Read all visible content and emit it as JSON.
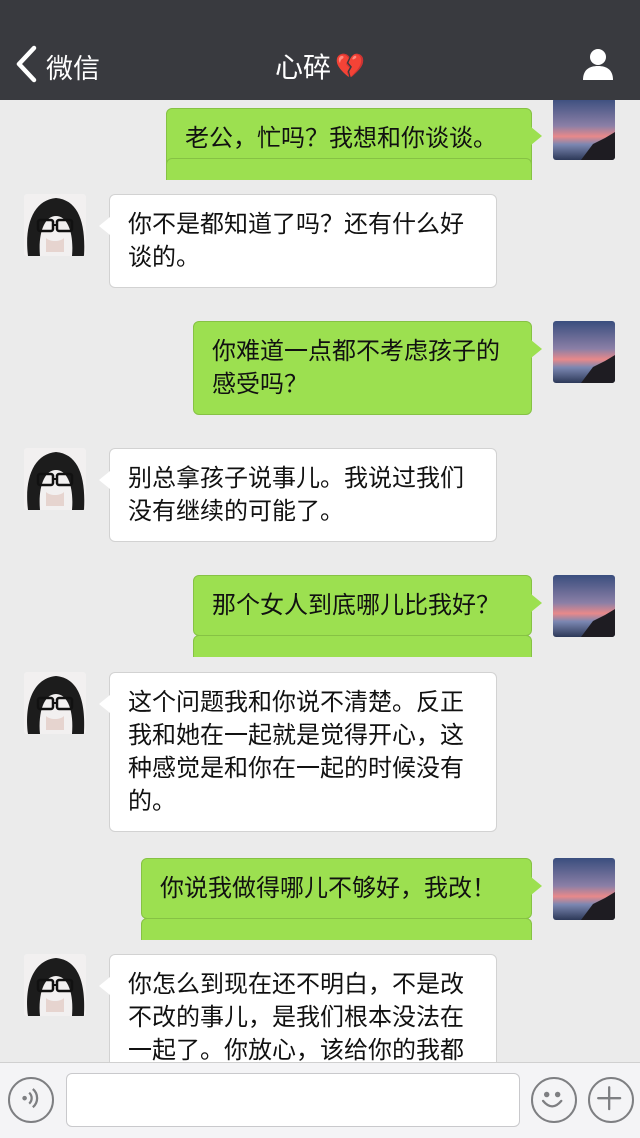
{
  "header": {
    "back_label": "微信",
    "title": "心碎",
    "title_emoji": "💔",
    "icons": {
      "back": "chevron-left-icon",
      "profile": "person-icon"
    }
  },
  "messages": [
    {
      "sender": "me",
      "text": "老公，忙吗？我想和你谈谈。"
    },
    {
      "sender": "her",
      "text": "你不是都知道了吗？还有什么好谈的。"
    },
    {
      "sender": "me",
      "text": "你难道一点都不考虑孩子的感受吗？"
    },
    {
      "sender": "her",
      "text": "别总拿孩子说事儿。我说过我们没有继续的可能了。"
    },
    {
      "sender": "me",
      "text": "那个女人到底哪儿比我好？"
    },
    {
      "sender": "her",
      "text": "这个问题我和你说不清楚。反正我和她在一起就是觉得开心，这种感觉是和你在一起的时候没有的。"
    },
    {
      "sender": "me",
      "text": "你说我做得哪儿不够好，我改！"
    },
    {
      "sender": "her",
      "text": "你怎么到现在还不明白，不是改不改的事儿，是我们根本没法在一起了。你放心，该给你的我都"
    }
  ],
  "input_bar": {
    "text_value": "",
    "icons": {
      "voice": "voice-icon",
      "emoji": "emoji-icon",
      "more": "plus-icon"
    }
  },
  "colors": {
    "header_bg": "#393a3f",
    "chat_bg": "#ebebeb",
    "my_bubble": "#9ce050",
    "their_bubble": "#ffffff"
  }
}
